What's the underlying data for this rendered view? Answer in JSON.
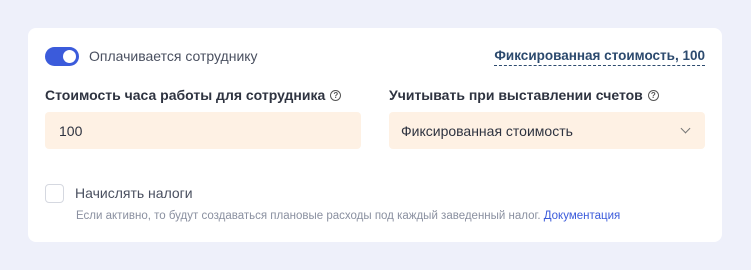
{
  "toggle": {
    "label": "Оплачивается сотруднику",
    "state": "on"
  },
  "fixed_link": "Фиксированная стоимость, 100",
  "cost_field": {
    "label": "Стоимость часа работы для сотрудника",
    "value": "100"
  },
  "billing_field": {
    "label": "Учитывать при выставлении счетов",
    "value": "Фиксированная стоимость"
  },
  "taxes": {
    "label": "Начислять налоги",
    "checked": false,
    "hint": "Если активно, то будут создаваться плановые расходы под каждый заведенный налог.",
    "link": "Документация"
  },
  "help_icon_glyph": "?",
  "colors": {
    "accent": "#3b5bdb",
    "input_bg": "#fef1e4",
    "page_bg": "#eef0fa"
  }
}
